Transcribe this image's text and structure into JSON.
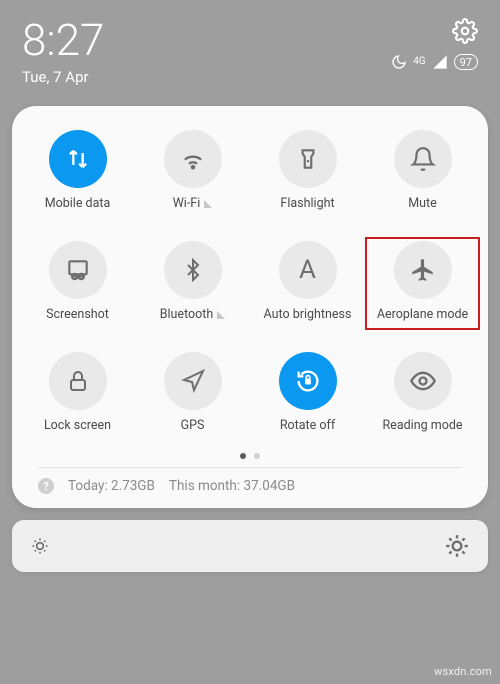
{
  "status": {
    "time": "8:27",
    "date": "Tue, 7 Apr",
    "network_label": "4G",
    "battery": "97"
  },
  "tiles": [
    {
      "label": "Mobile data",
      "active": true
    },
    {
      "label": "Wi-Fi"
    },
    {
      "label": "Flashlight"
    },
    {
      "label": "Mute"
    },
    {
      "label": "Screenshot"
    },
    {
      "label": "Bluetooth"
    },
    {
      "label": "Auto brightness"
    },
    {
      "label": "Aeroplane mode",
      "highlighted": true
    },
    {
      "label": "Lock screen"
    },
    {
      "label": "GPS"
    },
    {
      "label": "Rotate off",
      "active": true
    },
    {
      "label": "Reading mode"
    }
  ],
  "data_usage": {
    "today_label": "Today:",
    "today_value": "2.73GB",
    "month_label": "This month:",
    "month_value": "37.04GB"
  },
  "watermark": "wsxdn.com"
}
